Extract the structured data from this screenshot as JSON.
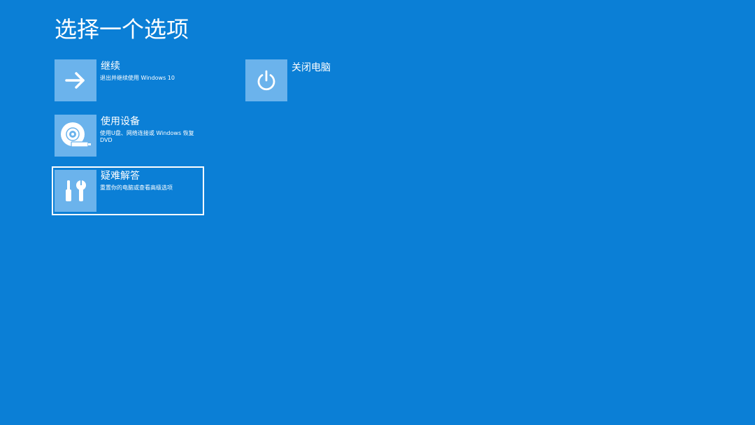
{
  "page": {
    "title": "选择一个选项",
    "background_color": "#0b7fd6",
    "tile_color": "#6bb3ec"
  },
  "options": [
    {
      "id": "continue",
      "title": "继续",
      "description": "退出并继续使用 Windows 10",
      "icon": "arrow-right-icon"
    },
    {
      "id": "shutdown",
      "title": "关闭电脑",
      "description": "",
      "icon": "power-icon"
    },
    {
      "id": "use-device",
      "title": "使用设备",
      "description": "使用U盘、网络连接或 Windows 恢复 DVD",
      "icon": "disc-drive-icon"
    },
    {
      "id": "troubleshoot",
      "title": "疑难解答",
      "description": "重置你的电脑或查看高级选项",
      "icon": "tools-icon",
      "selected": true
    }
  ]
}
